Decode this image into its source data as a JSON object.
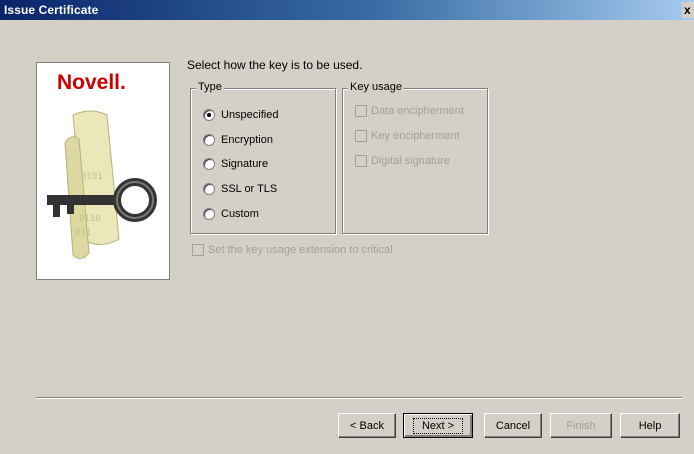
{
  "window": {
    "title": "Issue Certificate",
    "close_label": "x"
  },
  "logo": {
    "brand": "Novell."
  },
  "prompt": "Select how the key is to be used.",
  "type_group": {
    "label": "Type",
    "options": [
      {
        "label": "Unspecified",
        "checked": true
      },
      {
        "label": "Encryption",
        "checked": false
      },
      {
        "label": "Signature",
        "checked": false
      },
      {
        "label": "SSL or TLS",
        "checked": false
      },
      {
        "label": "Custom",
        "checked": false
      }
    ]
  },
  "usage_group": {
    "label": "Key usage",
    "options": [
      {
        "label": "Data encipherment",
        "enabled": false
      },
      {
        "label": "Key encipherment",
        "enabled": false
      },
      {
        "label": "Digital signature",
        "enabled": false
      }
    ]
  },
  "critical_option": {
    "label": "Set the key usage extension to critical",
    "enabled": false
  },
  "buttons": {
    "back": "< Back",
    "next": "Next >",
    "cancel": "Cancel",
    "finish": "Finish",
    "help": "Help"
  }
}
